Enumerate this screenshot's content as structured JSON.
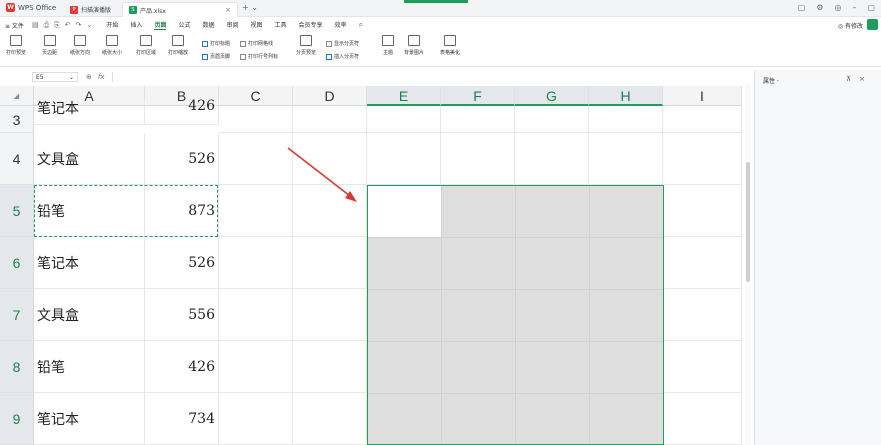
{
  "titlebar": {
    "app_name": "WPS Office",
    "logo_letter": "W",
    "tabs": [
      {
        "label": "扫描演播版",
        "icon_letter": "P",
        "icon": "pdf-icon",
        "color": "#e23c3c"
      },
      {
        "label": "产品.xlsx",
        "icon_letter": "S",
        "icon": "spreadsheet-icon",
        "color": "#1f9e5a"
      }
    ],
    "tab_close": "×",
    "new_tab": "+ ⌄",
    "window_controls": [
      "▢",
      "⚙",
      "◎",
      "–",
      "▢"
    ]
  },
  "menu": {
    "file_label": "≡ 文件",
    "quick_icons": [
      "▤",
      "⎙",
      "⎘",
      "↶",
      "↷",
      "⌄"
    ],
    "items": [
      "开始",
      "插入",
      "页面",
      "公式",
      "数据",
      "审阅",
      "视图",
      "工具",
      "会员专享",
      "效率"
    ],
    "active_item": "页面",
    "search_icon": "⌕",
    "collab_label": "◎ 有修改",
    "accent": "#1f9e5a"
  },
  "ribbon": {
    "buttons": [
      "打印预览",
      "页边距",
      "纸张方向",
      "纸张大小",
      "打印区域",
      "打印缩放",
      "打印标题",
      "页眉页脚",
      "分页预览",
      "插入分页符",
      "主题",
      "背景图片",
      "表格美化"
    ],
    "checkboxes": [
      "打印网格线",
      "打印行号列标",
      "显示分页符"
    ]
  },
  "formula": {
    "cell_ref": "E5",
    "dropdown": "⌄",
    "zoom_icon": "⊕",
    "fx": "fx"
  },
  "side_panel": {
    "title": "属性 ·",
    "pin": "⊼",
    "close": "×"
  },
  "grid": {
    "corner": "◢",
    "columns": [
      "A",
      "B",
      "C",
      "D",
      "E",
      "F",
      "G",
      "H",
      "I"
    ],
    "selected_columns": [
      "E",
      "F",
      "G",
      "H"
    ],
    "rows": [
      {
        "num": "3",
        "a": "笔记本",
        "b": "426"
      },
      {
        "num": "4",
        "a": "文具盒",
        "b": "526"
      },
      {
        "num": "5",
        "a": "铅笔",
        "b": "873"
      },
      {
        "num": "6",
        "a": "笔记本",
        "b": "526"
      },
      {
        "num": "7",
        "a": "文具盒",
        "b": "556"
      },
      {
        "num": "8",
        "a": "铅笔",
        "b": "426"
      },
      {
        "num": "9",
        "a": "笔记本",
        "b": "734"
      }
    ],
    "selected_rows": [
      "5",
      "6",
      "7",
      "8",
      "9"
    ],
    "selection_color": "#1f9e5a",
    "arrow_color": "#d8382d"
  }
}
